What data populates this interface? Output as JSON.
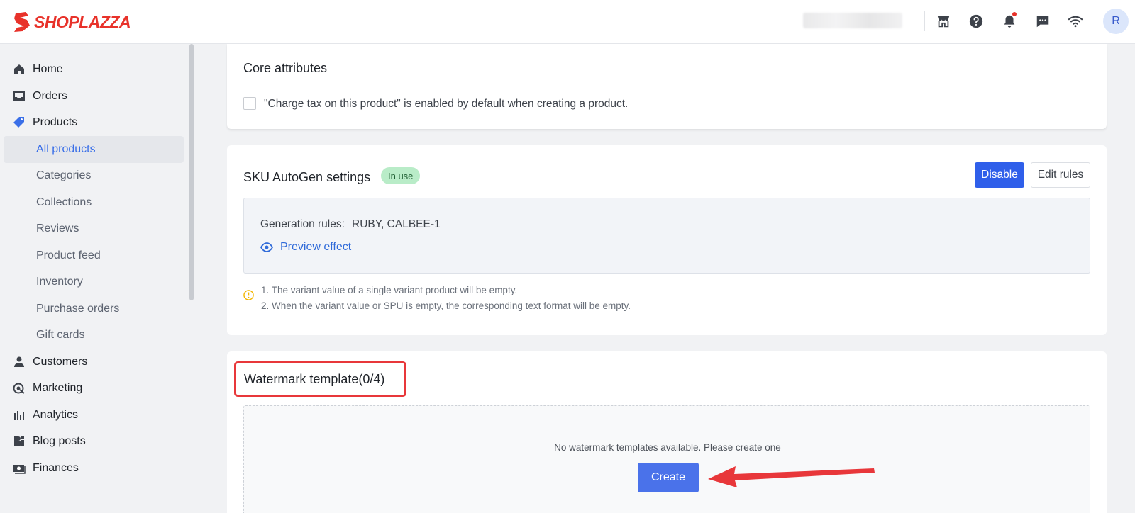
{
  "brand": {
    "name": "SHOPLAZZA",
    "color": "#e8322a"
  },
  "topbar": {
    "icons": [
      "store-icon",
      "help-icon",
      "bell-icon",
      "message-icon",
      "wifi-icon"
    ],
    "avatar_initial": "R"
  },
  "sidebar": {
    "items": [
      {
        "label": "Home",
        "icon": "home-icon"
      },
      {
        "label": "Orders",
        "icon": "orders-icon"
      },
      {
        "label": "Products",
        "icon": "tag-icon"
      },
      {
        "label": "Customers",
        "icon": "person-icon"
      },
      {
        "label": "Marketing",
        "icon": "marketing-icon"
      },
      {
        "label": "Analytics",
        "icon": "analytics-icon"
      },
      {
        "label": "Blog posts",
        "icon": "blog-icon"
      },
      {
        "label": "Finances",
        "icon": "finances-icon"
      }
    ],
    "product_subitems": [
      {
        "label": "All products",
        "active": true
      },
      {
        "label": "Categories"
      },
      {
        "label": "Collections"
      },
      {
        "label": "Reviews"
      },
      {
        "label": "Product feed"
      },
      {
        "label": "Inventory"
      },
      {
        "label": "Purchase orders"
      },
      {
        "label": "Gift cards"
      }
    ]
  },
  "core_attributes": {
    "title": "Core attributes",
    "checkbox_label": "\"Charge tax on this product\" is enabled by default when creating a product.",
    "checked": false
  },
  "sku_autogen": {
    "title": "SKU AutoGen settings",
    "badge": "In use",
    "disable_label": "Disable",
    "edit_label": "Edit rules",
    "rules_label": "Generation rules:",
    "rules_value": "RUBY, CALBEE-1",
    "preview_label": "Preview effect",
    "notes": [
      "1. The variant value of a single variant product will be empty.",
      "2. When the variant value or SPU is empty, the corresponding text format will be empty."
    ]
  },
  "watermark": {
    "title": "Watermark template(0/4)",
    "empty_text": "No watermark templates available. Please create one",
    "create_label": "Create"
  },
  "colors": {
    "primary": "#2f5fea",
    "badge_bg": "#b9ecc8",
    "highlight": "#e8373a",
    "link": "#2f6ad9"
  }
}
